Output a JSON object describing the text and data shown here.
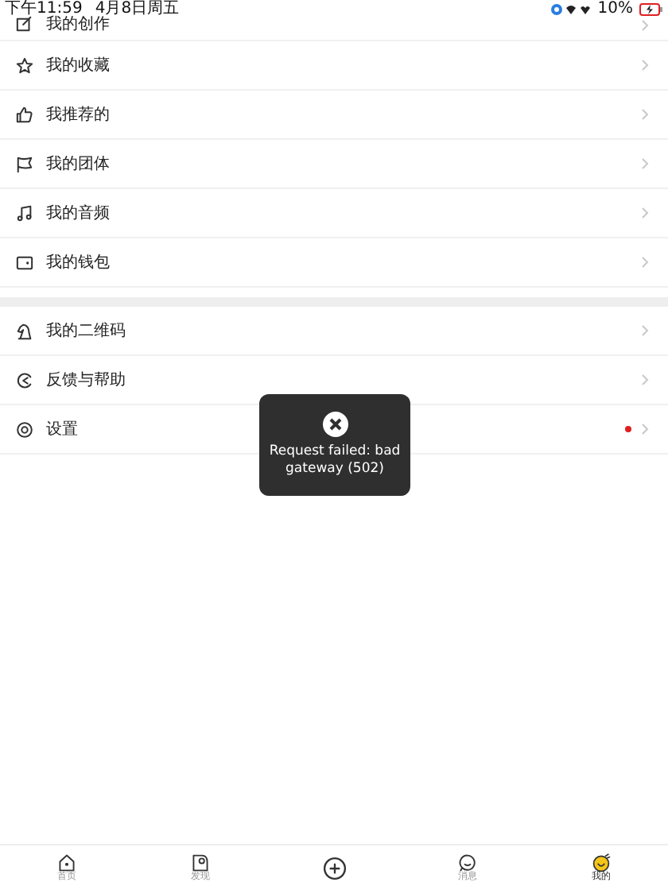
{
  "status_bar": {
    "time": "下午11:59",
    "date": "4月8日周五",
    "battery": "10%"
  },
  "menu_groups": [
    {
      "items": [
        {
          "label": "我的创作",
          "badge": false
        },
        {
          "label": "我的收藏",
          "badge": false
        },
        {
          "label": "我推荐的",
          "badge": false
        },
        {
          "label": "我的团体",
          "badge": false
        },
        {
          "label": "我的音频",
          "badge": false
        },
        {
          "label": "我的钱包",
          "badge": false
        }
      ]
    },
    {
      "items": [
        {
          "label": "我的二维码",
          "badge": false
        },
        {
          "label": "反馈与帮助",
          "badge": false
        },
        {
          "label": "设置",
          "badge": true
        }
      ]
    }
  ],
  "toast": {
    "message": "Request failed: bad gateway (502)"
  },
  "tab_bar": [
    {
      "label": "首页",
      "selected": false
    },
    {
      "label": "发现",
      "selected": false
    },
    {
      "selected": false
    },
    {
      "label": "消息",
      "selected": false
    },
    {
      "label": "我的",
      "selected": true
    }
  ]
}
